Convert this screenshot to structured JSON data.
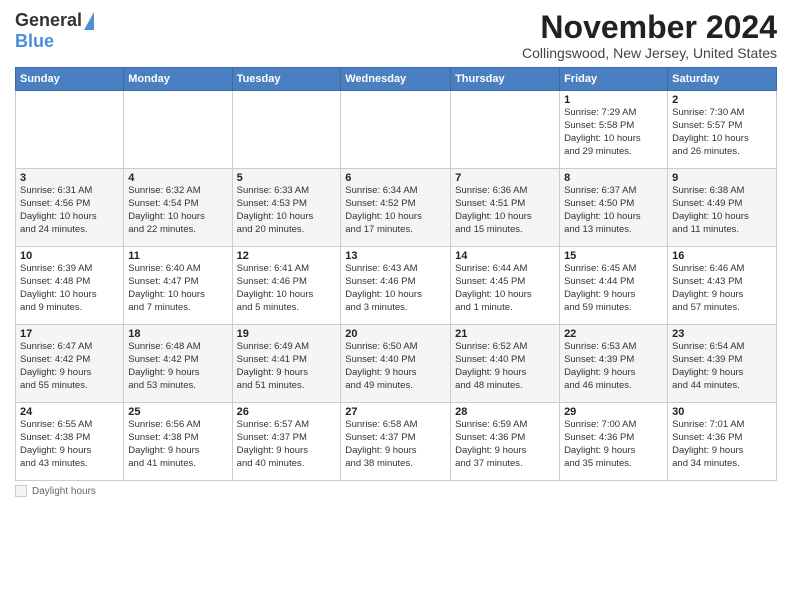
{
  "header": {
    "logo_general": "General",
    "logo_blue": "Blue",
    "month_title": "November 2024",
    "location": "Collingswood, New Jersey, United States"
  },
  "columns": [
    "Sunday",
    "Monday",
    "Tuesday",
    "Wednesday",
    "Thursday",
    "Friday",
    "Saturday"
  ],
  "weeks": [
    [
      {
        "day": "",
        "info": ""
      },
      {
        "day": "",
        "info": ""
      },
      {
        "day": "",
        "info": ""
      },
      {
        "day": "",
        "info": ""
      },
      {
        "day": "",
        "info": ""
      },
      {
        "day": "1",
        "info": "Sunrise: 7:29 AM\nSunset: 5:58 PM\nDaylight: 10 hours\nand 29 minutes."
      },
      {
        "day": "2",
        "info": "Sunrise: 7:30 AM\nSunset: 5:57 PM\nDaylight: 10 hours\nand 26 minutes."
      }
    ],
    [
      {
        "day": "3",
        "info": "Sunrise: 6:31 AM\nSunset: 4:56 PM\nDaylight: 10 hours\nand 24 minutes."
      },
      {
        "day": "4",
        "info": "Sunrise: 6:32 AM\nSunset: 4:54 PM\nDaylight: 10 hours\nand 22 minutes."
      },
      {
        "day": "5",
        "info": "Sunrise: 6:33 AM\nSunset: 4:53 PM\nDaylight: 10 hours\nand 20 minutes."
      },
      {
        "day": "6",
        "info": "Sunrise: 6:34 AM\nSunset: 4:52 PM\nDaylight: 10 hours\nand 17 minutes."
      },
      {
        "day": "7",
        "info": "Sunrise: 6:36 AM\nSunset: 4:51 PM\nDaylight: 10 hours\nand 15 minutes."
      },
      {
        "day": "8",
        "info": "Sunrise: 6:37 AM\nSunset: 4:50 PM\nDaylight: 10 hours\nand 13 minutes."
      },
      {
        "day": "9",
        "info": "Sunrise: 6:38 AM\nSunset: 4:49 PM\nDaylight: 10 hours\nand 11 minutes."
      }
    ],
    [
      {
        "day": "10",
        "info": "Sunrise: 6:39 AM\nSunset: 4:48 PM\nDaylight: 10 hours\nand 9 minutes."
      },
      {
        "day": "11",
        "info": "Sunrise: 6:40 AM\nSunset: 4:47 PM\nDaylight: 10 hours\nand 7 minutes."
      },
      {
        "day": "12",
        "info": "Sunrise: 6:41 AM\nSunset: 4:46 PM\nDaylight: 10 hours\nand 5 minutes."
      },
      {
        "day": "13",
        "info": "Sunrise: 6:43 AM\nSunset: 4:46 PM\nDaylight: 10 hours\nand 3 minutes."
      },
      {
        "day": "14",
        "info": "Sunrise: 6:44 AM\nSunset: 4:45 PM\nDaylight: 10 hours\nand 1 minute."
      },
      {
        "day": "15",
        "info": "Sunrise: 6:45 AM\nSunset: 4:44 PM\nDaylight: 9 hours\nand 59 minutes."
      },
      {
        "day": "16",
        "info": "Sunrise: 6:46 AM\nSunset: 4:43 PM\nDaylight: 9 hours\nand 57 minutes."
      }
    ],
    [
      {
        "day": "17",
        "info": "Sunrise: 6:47 AM\nSunset: 4:42 PM\nDaylight: 9 hours\nand 55 minutes."
      },
      {
        "day": "18",
        "info": "Sunrise: 6:48 AM\nSunset: 4:42 PM\nDaylight: 9 hours\nand 53 minutes."
      },
      {
        "day": "19",
        "info": "Sunrise: 6:49 AM\nSunset: 4:41 PM\nDaylight: 9 hours\nand 51 minutes."
      },
      {
        "day": "20",
        "info": "Sunrise: 6:50 AM\nSunset: 4:40 PM\nDaylight: 9 hours\nand 49 minutes."
      },
      {
        "day": "21",
        "info": "Sunrise: 6:52 AM\nSunset: 4:40 PM\nDaylight: 9 hours\nand 48 minutes."
      },
      {
        "day": "22",
        "info": "Sunrise: 6:53 AM\nSunset: 4:39 PM\nDaylight: 9 hours\nand 46 minutes."
      },
      {
        "day": "23",
        "info": "Sunrise: 6:54 AM\nSunset: 4:39 PM\nDaylight: 9 hours\nand 44 minutes."
      }
    ],
    [
      {
        "day": "24",
        "info": "Sunrise: 6:55 AM\nSunset: 4:38 PM\nDaylight: 9 hours\nand 43 minutes."
      },
      {
        "day": "25",
        "info": "Sunrise: 6:56 AM\nSunset: 4:38 PM\nDaylight: 9 hours\nand 41 minutes."
      },
      {
        "day": "26",
        "info": "Sunrise: 6:57 AM\nSunset: 4:37 PM\nDaylight: 9 hours\nand 40 minutes."
      },
      {
        "day": "27",
        "info": "Sunrise: 6:58 AM\nSunset: 4:37 PM\nDaylight: 9 hours\nand 38 minutes."
      },
      {
        "day": "28",
        "info": "Sunrise: 6:59 AM\nSunset: 4:36 PM\nDaylight: 9 hours\nand 37 minutes."
      },
      {
        "day": "29",
        "info": "Sunrise: 7:00 AM\nSunset: 4:36 PM\nDaylight: 9 hours\nand 35 minutes."
      },
      {
        "day": "30",
        "info": "Sunrise: 7:01 AM\nSunset: 4:36 PM\nDaylight: 9 hours\nand 34 minutes."
      }
    ]
  ],
  "footer": {
    "daylight_hours_label": "Daylight hours"
  }
}
